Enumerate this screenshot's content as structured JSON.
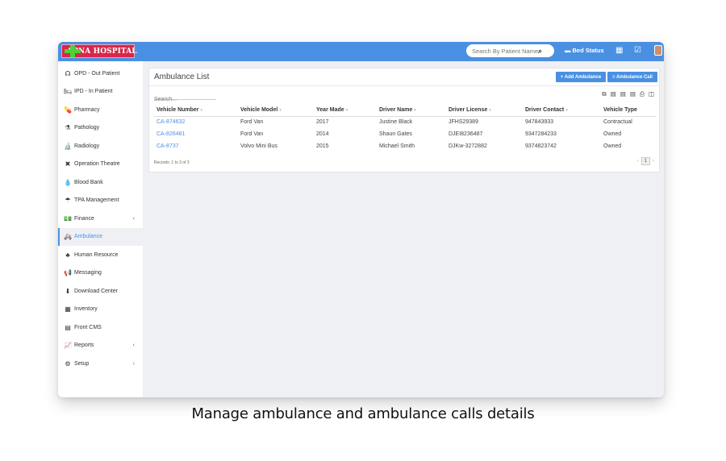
{
  "brand": {
    "name": "APNA HOSPITAL",
    "primary_color": "#4a90e2",
    "logo_color": "#d9264a"
  },
  "topbar": {
    "search_placeholder": "Search By Patient Name",
    "bed_status_label": "Bed Status"
  },
  "sidebar": {
    "items": [
      {
        "label": "OPD - Out Patient",
        "icon": "stethoscope-icon",
        "glyph": "☊"
      },
      {
        "label": "IPD - In Patient",
        "icon": "bed-icon",
        "glyph": "🛏"
      },
      {
        "label": "Pharmacy",
        "icon": "pills-icon",
        "glyph": "💊"
      },
      {
        "label": "Pathology",
        "icon": "flask-icon",
        "glyph": "⚗"
      },
      {
        "label": "Radiology",
        "icon": "microscope-icon",
        "glyph": "🔬"
      },
      {
        "label": "Operation Theatre",
        "icon": "scissors-icon",
        "glyph": "✖"
      },
      {
        "label": "Blood Bank",
        "icon": "blood-drop-icon",
        "glyph": "💧"
      },
      {
        "label": "TPA Management",
        "icon": "umbrella-icon",
        "glyph": "☂"
      },
      {
        "label": "Finance",
        "icon": "money-icon",
        "glyph": "💵",
        "caret": "‹"
      },
      {
        "label": "Ambulance",
        "icon": "ambulance-icon",
        "glyph": "🚑",
        "active": true
      },
      {
        "label": "Human Resource",
        "icon": "sitemap-icon",
        "glyph": "♣"
      },
      {
        "label": "Messaging",
        "icon": "megaphone-icon",
        "glyph": "📢"
      },
      {
        "label": "Download Center",
        "icon": "download-icon",
        "glyph": "⬇"
      },
      {
        "label": "Inventory",
        "icon": "truck-loading-icon",
        "glyph": "▦"
      },
      {
        "label": "Front CMS",
        "icon": "cms-icon",
        "glyph": "▤"
      },
      {
        "label": "Reports",
        "icon": "line-chart-icon",
        "glyph": "📈",
        "caret": "‹"
      },
      {
        "label": "Setup",
        "icon": "gears-icon",
        "glyph": "⚙",
        "caret": "‹"
      }
    ]
  },
  "panel": {
    "title": "Ambulance List",
    "add_button": "+ Add Ambulance",
    "call_button": "≡ Ambulance Call",
    "search_placeholder": "Search...",
    "columns": [
      "Vehicle Number",
      "Vehicle Model",
      "Year Made",
      "Driver Name",
      "Driver License",
      "Driver Contact",
      "Vehicle Type"
    ],
    "rows": [
      [
        "CA-874632",
        "Ford Van",
        "2017",
        "Justine Black",
        "JFHS29389",
        "947843933",
        "Contractual"
      ],
      [
        "CA-826481",
        "Ford Van",
        "2014",
        "Shaun Gates",
        "DJEI8236487",
        "9347284233",
        "Owned"
      ],
      [
        "CA-8737",
        "Volvo Mini Bus",
        "2015",
        "Michael Smith",
        "DJKw-3272882",
        "9374823742",
        "Owned"
      ]
    ],
    "records_text": "Records: 1 to 3 of 3",
    "page_current": "1"
  },
  "caption": "Manage ambulance and ambulance calls details"
}
